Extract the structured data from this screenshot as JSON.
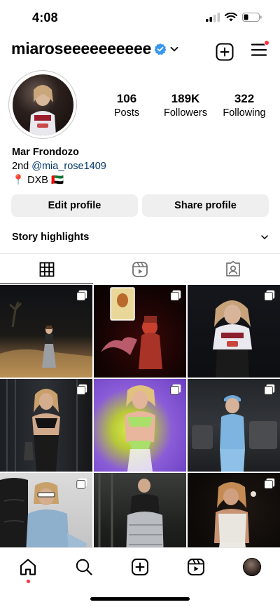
{
  "status": {
    "time": "4:08"
  },
  "profile": {
    "username": "miaroseeeeeeeeee",
    "verified": true,
    "display_name": "Mar Frondozo",
    "relation": "2nd",
    "linked_handle": "@mia_rose1409",
    "location_pin": "📍",
    "location": "DXB",
    "flag": "🇦🇪"
  },
  "stats": [
    {
      "value": "106",
      "label": "Posts"
    },
    {
      "value": "189K",
      "label": "Followers"
    },
    {
      "value": "322",
      "label": "Following"
    }
  ],
  "buttons": {
    "edit": "Edit profile",
    "share": "Share profile"
  },
  "highlights": {
    "label": "Story highlights"
  },
  "tabs": [
    {
      "name": "posts",
      "icon": "grid-icon",
      "active": true
    },
    {
      "name": "reels",
      "icon": "reels-icon",
      "active": false
    },
    {
      "name": "tagged",
      "icon": "tagged-icon",
      "active": false
    }
  ],
  "posts": [
    {
      "icon": "multi-photo-icon"
    },
    {
      "icon": "multi-photo-icon"
    },
    {
      "icon": "multi-photo-icon"
    },
    {
      "icon": "multi-photo-icon"
    },
    {
      "icon": "multi-photo-icon"
    },
    {
      "icon": "multi-photo-icon"
    },
    {
      "icon": "multi-photo-icon"
    },
    {
      "icon": "none"
    },
    {
      "icon": "multi-photo-icon"
    }
  ],
  "nav": [
    {
      "name": "home",
      "icon": "home-icon",
      "active": true
    },
    {
      "name": "search",
      "icon": "search-icon"
    },
    {
      "name": "create",
      "icon": "create-icon"
    },
    {
      "name": "reels",
      "icon": "reels-icon"
    },
    {
      "name": "profile",
      "icon": "profile-avatar"
    }
  ],
  "colors": {
    "verified": "#3897f0",
    "link": "#00376b",
    "notification": "#ff3040",
    "button_bg": "#efefef"
  }
}
